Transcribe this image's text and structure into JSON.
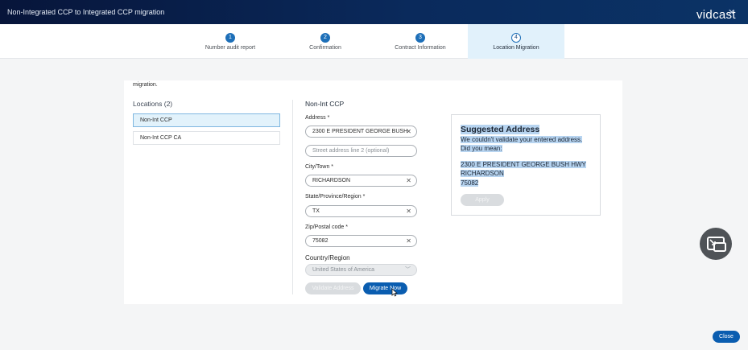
{
  "window": {
    "title": "Non-Integrated CCP to Integrated CCP migration",
    "brand": "vidcast"
  },
  "steps": [
    {
      "number": "1",
      "label": "Number audit report",
      "active": false
    },
    {
      "number": "2",
      "label": "Confirmation",
      "active": false
    },
    {
      "number": "3",
      "label": "Contract Information",
      "active": false
    },
    {
      "number": "4",
      "label": "Location Migration",
      "active": true
    }
  ],
  "intro_text": "migration.",
  "locations": {
    "heading": "Locations (2)",
    "items": [
      "Non-Int CCP",
      "Non-Int CCP CA"
    ]
  },
  "form": {
    "title": "Non-Int CCP",
    "address_label": "Address *",
    "address_value": "2300 E PRESIDENT GEORGE BUSH",
    "address2_placeholder": "Street address line 2 (optional)",
    "city_label": "City/Town *",
    "city_value": "RICHARDSON",
    "state_label": "State/Province/Region *",
    "state_value": "TX",
    "zip_label": "Zip/Postal code *",
    "zip_value": "75082",
    "country_label": "Country/Region",
    "country_value": "United States of America",
    "validate_label": "Validate Address",
    "migrate_label": "Migrate Now"
  },
  "suggestion": {
    "title": "Suggested Address",
    "message_line1": "We couldn't validate your entered address.",
    "message_line2": "Did you mean:",
    "street": "2300 E PRESIDENT GEORGE BUSH HWY",
    "city": "RICHARDSON",
    "zip": "75082",
    "apply_label": "Apply"
  },
  "footer": {
    "close_label": "Close"
  },
  "colors": {
    "primary": "#0a5db0",
    "header": "#07153a",
    "active_step": "#e1f1fb"
  }
}
